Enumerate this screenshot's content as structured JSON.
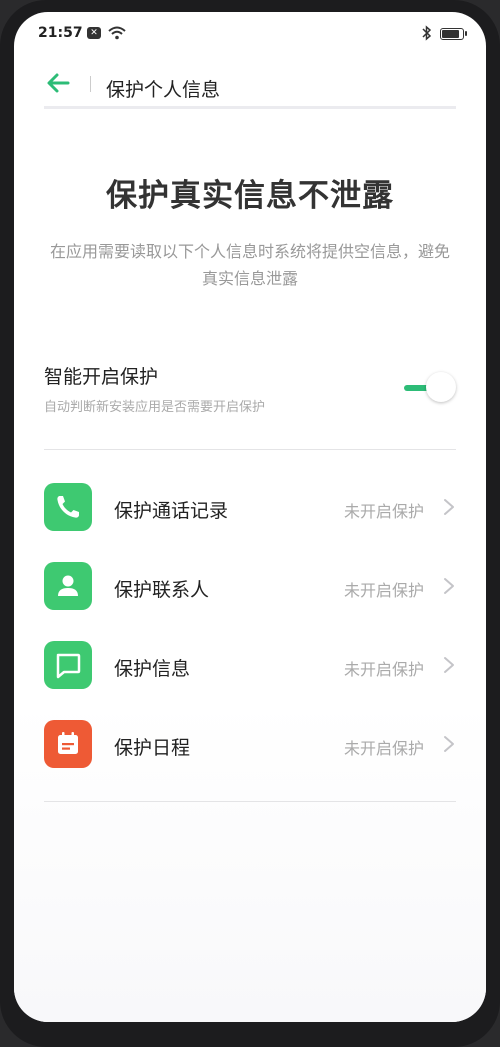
{
  "status_bar": {
    "time": "21:57",
    "icons": [
      "notification-icon",
      "wifi-icon",
      "bluetooth-icon",
      "battery-icon"
    ]
  },
  "header": {
    "title": "保护个人信息",
    "back_icon": "arrow-left-icon"
  },
  "hero": {
    "title": "保护真实信息不泄露",
    "description": "在应用需要读取以下个人信息时系统将提供空信息，避免真实信息泄露"
  },
  "smart_protect": {
    "label": "智能开启保护",
    "sublabel": "自动判断新安装应用是否需要开启保护",
    "enabled": true
  },
  "items": [
    {
      "label": "保护通话记录",
      "status": "未开启保护",
      "icon": "phone-icon",
      "color": "#3ec971"
    },
    {
      "label": "保护联系人",
      "status": "未开启保护",
      "icon": "contact-icon",
      "color": "#3ec971"
    },
    {
      "label": "保护信息",
      "status": "未开启保护",
      "icon": "message-icon",
      "color": "#3ec971"
    },
    {
      "label": "保护日程",
      "status": "未开启保护",
      "icon": "calendar-icon",
      "color": "#ee5a35"
    }
  ],
  "colors": {
    "accent": "#2dbc77",
    "green_icon": "#3ec971",
    "orange_icon": "#ee5a35"
  }
}
